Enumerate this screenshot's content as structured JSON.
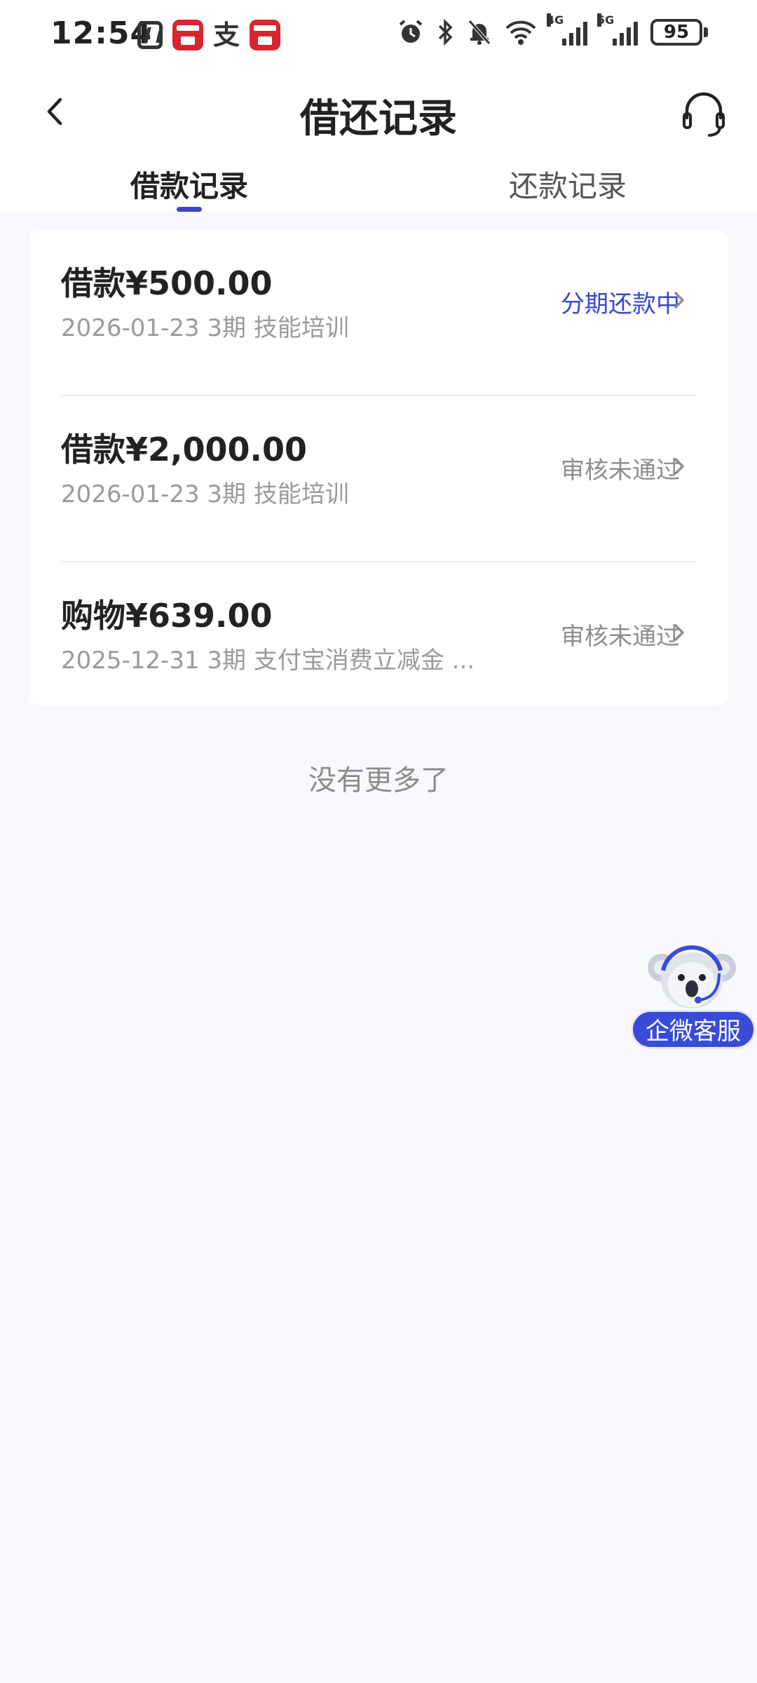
{
  "status_bar": {
    "time": "12:54",
    "battery": "95",
    "icons": [
      "nfc-icon",
      "app-icon",
      "alipay-icon",
      "app-icon",
      "alarm-icon",
      "bluetooth-icon",
      "mute-icon",
      "wifi-icon",
      "signal-4g-icon",
      "signal-5g-icon",
      "battery-icon"
    ],
    "net_4g": "4G",
    "net_5g": "5G"
  },
  "header": {
    "title": "借还记录",
    "back_icon": "chevron-left-icon",
    "support_icon": "headset-icon"
  },
  "tabs": [
    {
      "label": "借款记录",
      "active": true
    },
    {
      "label": "还款记录",
      "active": false
    }
  ],
  "records": [
    {
      "title": "借款¥500.00",
      "subtitle": "2026-01-23 3期  技能培训",
      "status": "分期还款中",
      "status_color": "#3a47c7"
    },
    {
      "title": "借款¥2,000.00",
      "subtitle": "2026-01-23 3期  技能培训",
      "status": "审核未通过",
      "status_color": "#8e8e8e"
    },
    {
      "title": "购物¥639.00",
      "subtitle": "2025-12-31 3期  支付宝消费立减金 ...",
      "status": "审核未通过",
      "status_color": "#8e8e8e"
    }
  ],
  "footer_note": "没有更多了",
  "float_service": {
    "label": "企微客服",
    "icon": "koala-mascot-icon"
  },
  "colors": {
    "accent": "#3a47c7",
    "float_bg": "#3a4bd8",
    "page_bg": "#f8f9fd"
  }
}
